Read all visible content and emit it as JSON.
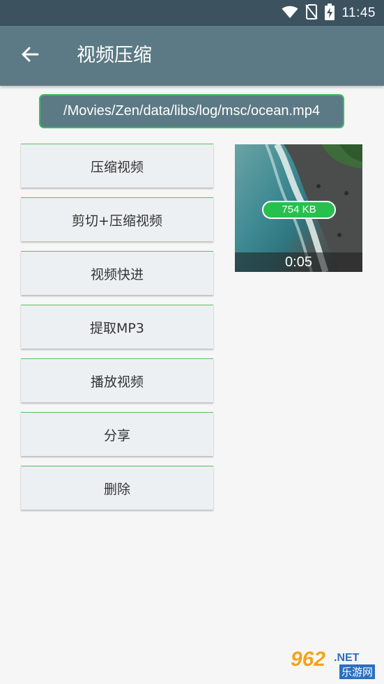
{
  "status": {
    "time": "11:45"
  },
  "toolbar": {
    "title": "视频压缩"
  },
  "file": {
    "path": "/Movies/Zen/data/libs/log/msc/ocean.mp4"
  },
  "actions": [
    {
      "label": "压缩视频"
    },
    {
      "label": "剪切+压缩视频"
    },
    {
      "label": "视频快进"
    },
    {
      "label": "提取MP3"
    },
    {
      "label": "播放视频"
    },
    {
      "label": "分享"
    },
    {
      "label": "删除"
    }
  ],
  "thumbnail": {
    "size": "754 KB",
    "duration": "0:05"
  },
  "watermark": {
    "number": "962",
    "suffix": ".NET",
    "text": "乐游网"
  },
  "colors": {
    "statusbar": "#3c525f",
    "toolbar": "#5c7a85",
    "accent_green": "#27c04e",
    "button_bg": "#edf0f2",
    "background": "#f6f6f6"
  },
  "icons": [
    "wifi-icon",
    "no-sim-icon",
    "battery-charging-icon",
    "back-arrow-icon"
  ]
}
